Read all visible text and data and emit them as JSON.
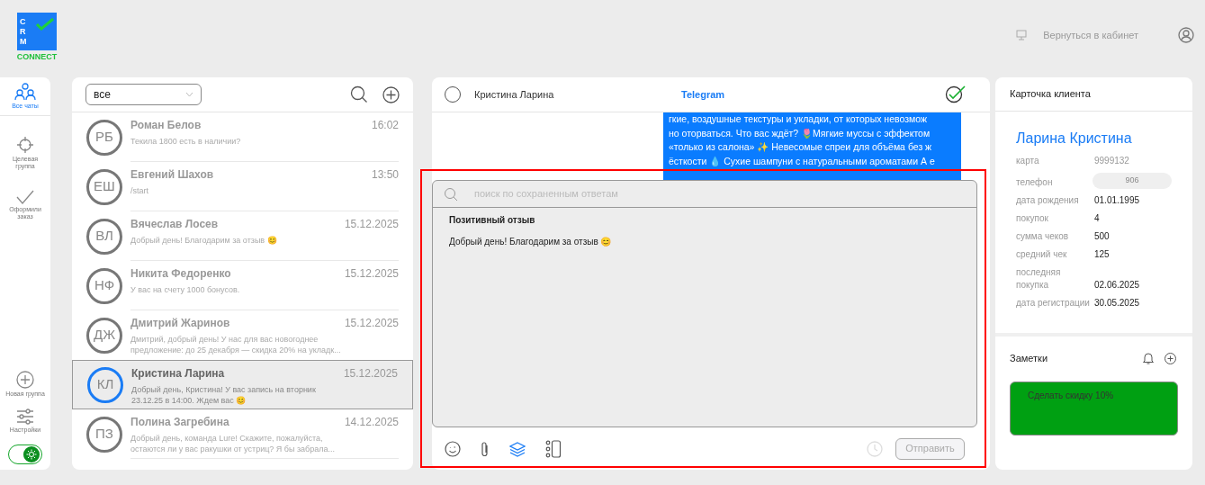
{
  "logo": {
    "letters": [
      "C",
      "R",
      "M"
    ],
    "word": "CONNECT"
  },
  "header": {
    "back_link": "Вернуться в кабинет"
  },
  "nav": {
    "top": [
      {
        "label": "Все чаты",
        "kind": "users",
        "selected": true
      },
      {
        "label": "Целевая группа",
        "kind": "target",
        "selected": false
      },
      {
        "label": "Оформили заказ",
        "kind": "check",
        "selected": false
      }
    ],
    "bottom": [
      {
        "label": "Новая группа",
        "kind": "plus"
      },
      {
        "label": "Настройки",
        "kind": "sliders"
      }
    ],
    "theme_toggle": {
      "on": true
    }
  },
  "chat_list": {
    "filter": "все",
    "chats": [
      {
        "initials": "РБ",
        "name": "Роман Белов",
        "time": "16:02",
        "preview": "Текила 1800 есть в наличии?",
        "selected": false
      },
      {
        "initials": "ЕШ",
        "name": "Евгений Шахов",
        "time": "13:50",
        "preview": "/start",
        "selected": false
      },
      {
        "initials": "ВЛ",
        "name": "Вячеслав Лосев",
        "time": "15.12.2025",
        "preview": "Добрый день! Благодарим за отзыв 😊",
        "selected": false
      },
      {
        "initials": "НФ",
        "name": "Никита Федоренко",
        "time": "15.12.2025",
        "preview": "У вас на счету 1000 бонусов.",
        "selected": false
      },
      {
        "initials": "ДЖ",
        "name": "Дмитрий Жаринов",
        "time": "15.12.2025",
        "preview": "Дмитрий, добрый день! У нас для вас новогоднее предложение: до 25 декабря — скидка 20% на укладк...",
        "selected": false
      },
      {
        "initials": "КЛ",
        "name": "Кристина Ларина",
        "time": "15.12.2025",
        "preview": "Добрый день, Кристина! У вас запись на вторник 23.12.25 в 14:00. Ждем вас 😊",
        "selected": true
      },
      {
        "initials": "ПЗ",
        "name": "Полина Загребина",
        "time": "14.12.2025",
        "preview": "Добрый день, команда Lure! Скажите, пожалуйста, остаются ли у вас ракушки от устриц? Я бы забрала...",
        "selected": false
      }
    ]
  },
  "chat": {
    "selected": false,
    "name": "Кристина Ларина",
    "channel": "Telegram",
    "message_lines": [
      "гкие, воздушные текстуры и укладки, от которых невозмож",
      "но оторваться. Что вас ждёт? 🌷Мягкие муссы с эффектом",
      "«только из салона» ✨ Невесомые спреи для объёма без ж",
      "ёсткости 💧 Сухие шампуни с натуральными ароматами А е"
    ],
    "saved_replies": {
      "placeholder": "поиск по сохраненным ответам",
      "items": [
        {
          "title": "Позитивный отзыв",
          "text": "Добрый день! Благодарим за отзыв 😊"
        }
      ]
    },
    "send_button": "Отправить"
  },
  "client_card": {
    "title": "Карточка клиента",
    "name": "Ларина Кристина",
    "fields": [
      {
        "label": "карта",
        "value": "9999132",
        "kind": "muted"
      },
      {
        "label": "телефон",
        "value": "906",
        "kind": "blurred"
      },
      {
        "label": "дата рождения",
        "value": "01.01.1995",
        "kind": "plain"
      },
      {
        "label": "покупок",
        "value": "4",
        "kind": "plain"
      },
      {
        "label": "сумма чеков",
        "value": "500",
        "kind": "plain"
      },
      {
        "label": "средний чек",
        "value": "125",
        "kind": "plain"
      },
      {
        "label": "последняя покупка",
        "value": "02.06.2025",
        "kind": "plain"
      },
      {
        "label": "дата регистрации",
        "value": "30.05.2025",
        "kind": "plain"
      }
    ],
    "notes_title": "Заметки",
    "notes": [
      {
        "text": "Сделать скидку 10%",
        "color": "#00a012"
      }
    ]
  }
}
